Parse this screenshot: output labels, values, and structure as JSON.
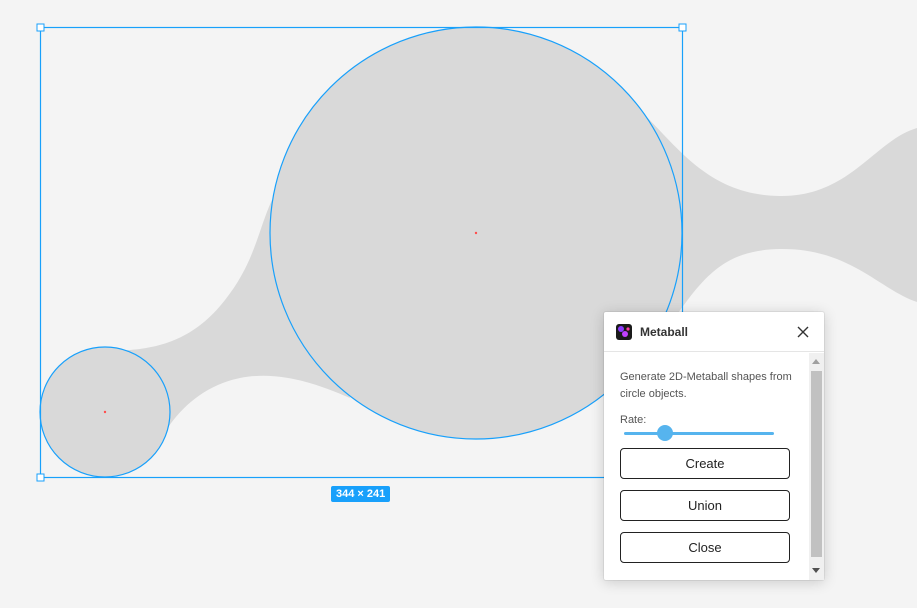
{
  "selection": {
    "size_label": "344 × 241",
    "accent_color": "#18a0fb"
  },
  "canvas": {
    "background_color": "#f4f4f4",
    "shape_fill_color": "#d9d9d9"
  },
  "plugin": {
    "title": "Metaball",
    "icon": "metaball-plugin-icon",
    "close_icon": "close-icon",
    "description": "Generate 2D-Metaball shapes from circle objects.",
    "rate_label": "Rate:",
    "rate_value": 0.27,
    "buttons": {
      "create": "Create",
      "union": "Union",
      "close": "Close"
    }
  }
}
